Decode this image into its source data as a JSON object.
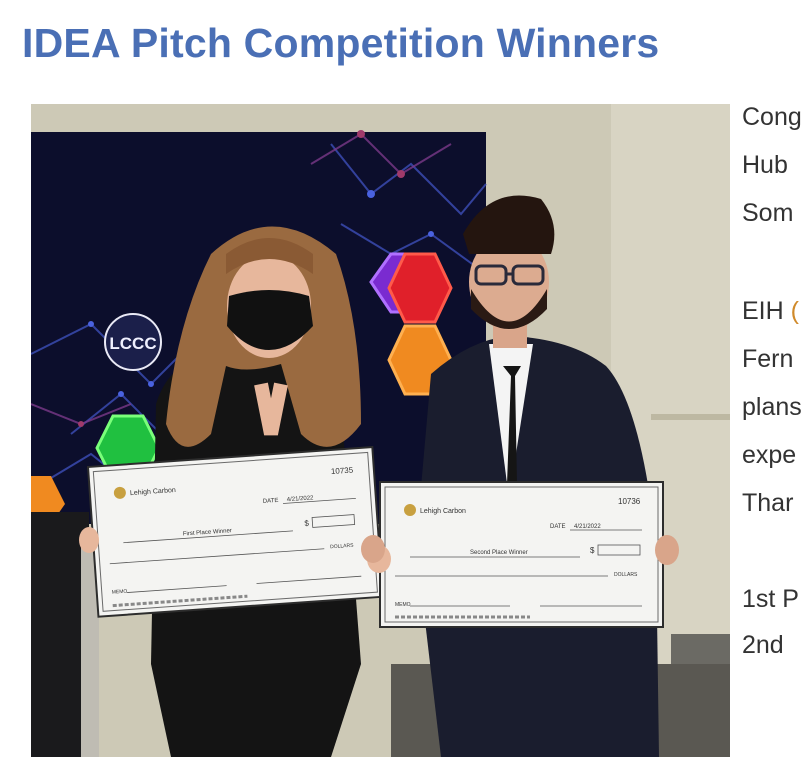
{
  "page": {
    "title": "IDEA Pitch Competition Winners"
  },
  "photo": {
    "logo_text": "LCCC",
    "check_left": {
      "number": "10735",
      "bank": "Lehigh Carbon",
      "date_label": "DATE",
      "date": "4/21/2022",
      "pay_to": "First Place Winner",
      "dollar_sign": "$",
      "dollars_label": "DOLLARS",
      "memo_label": "MEMO"
    },
    "check_right": {
      "number": "10736",
      "bank": "Lehigh Carbon",
      "date_label": "DATE",
      "date": "4/21/2022",
      "pay_to": "Second Place Winner",
      "dollar_sign": "$",
      "dollars_label": "DOLLARS",
      "memo_label": "MEMO"
    }
  },
  "article": {
    "lines": [
      "Cong",
      "Hub",
      "Som",
      "EIH",
      "Fern",
      "plans",
      "expe",
      "Thar",
      "1st P",
      "2nd"
    ]
  }
}
